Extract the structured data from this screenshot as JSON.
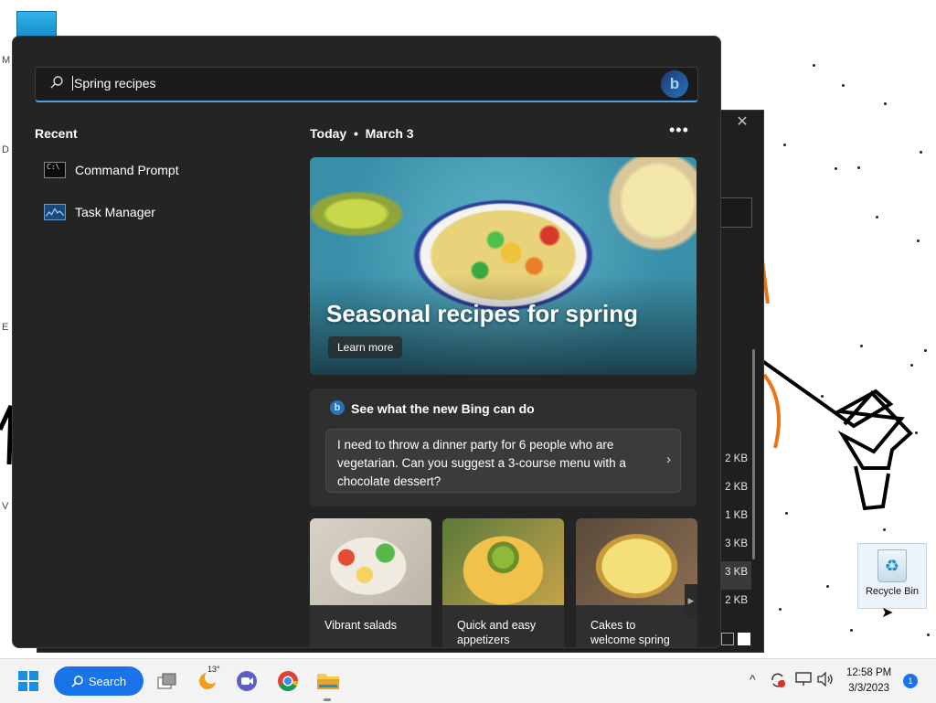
{
  "search": {
    "value": "Spring recipes"
  },
  "recent": {
    "title": "Recent",
    "items": [
      {
        "label": "Command Prompt",
        "icon": "command-prompt-icon"
      },
      {
        "label": "Task Manager",
        "icon": "task-manager-icon"
      }
    ]
  },
  "today": {
    "label": "Today",
    "date": "March 3",
    "more": "•••"
  },
  "hero": {
    "title": "Seasonal recipes for spring",
    "button": "Learn more"
  },
  "bing": {
    "heading": "See what the new Bing can do",
    "prompt": "I need to throw a dinner party for 6 people who are vegetarian. Can you suggest a 3-course menu with a chocolate dessert?"
  },
  "tiles": [
    {
      "label": "Vibrant salads"
    },
    {
      "label": "Quick and easy appetizers"
    },
    {
      "label": "Cakes to welcome spring"
    }
  ],
  "background_window": {
    "sizes": [
      "2 KB",
      "2 KB",
      "1 KB",
      "3 KB",
      "3 KB",
      "2 KB"
    ],
    "close": "✕"
  },
  "desktop": {
    "recycle_bin_label": "Recycle Bin"
  },
  "taskbar": {
    "search_label": "Search",
    "weather_temp": "13°",
    "time": "12:58 PM",
    "date": "3/3/2023",
    "notification_count": "1"
  },
  "colors": {
    "accent": "#1a73e8",
    "panel_bg": "#242424",
    "card_bg": "#2f2f2f"
  }
}
